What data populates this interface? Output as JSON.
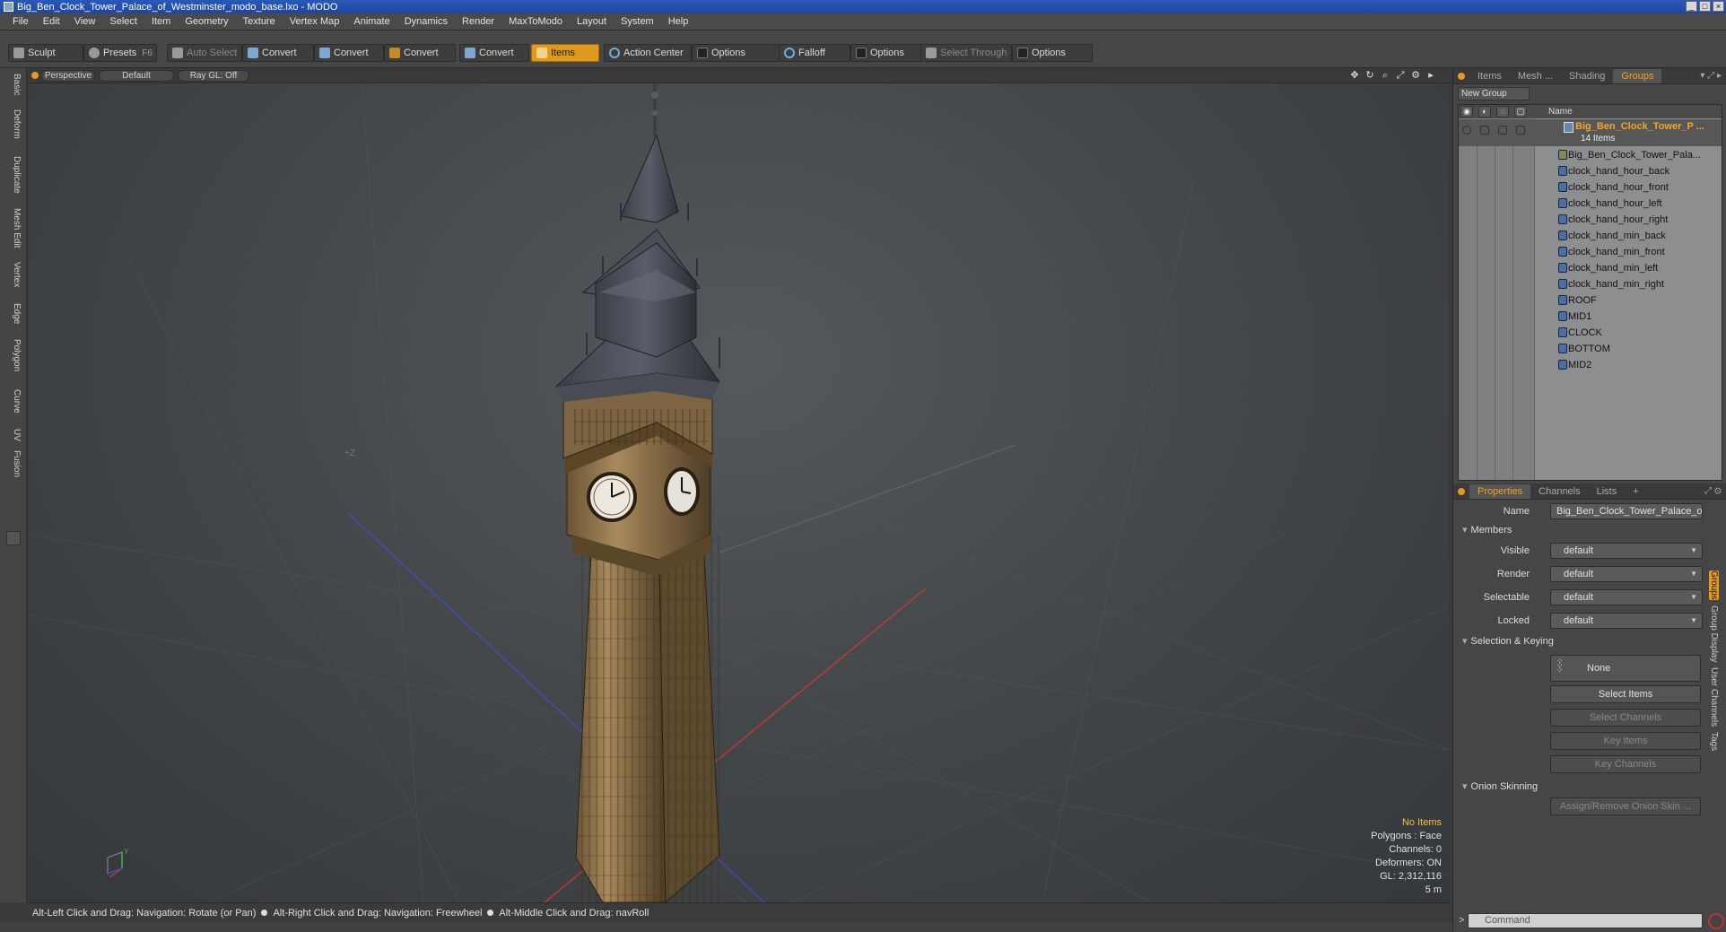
{
  "window": {
    "title": "Big_Ben_Clock_Tower_Palace_of_Westminster_modo_base.lxo - MODO"
  },
  "menu": [
    "File",
    "Edit",
    "View",
    "Select",
    "Item",
    "Geometry",
    "Texture",
    "Vertex Map",
    "Animate",
    "Dynamics",
    "Render",
    "MaxToModo",
    "Layout",
    "System",
    "Help"
  ],
  "toolbar": {
    "sculpt": "Sculpt",
    "presets": "Presets",
    "presets_key": "F6",
    "auto_select": "Auto Select",
    "convert1": "Convert",
    "convert2": "Convert",
    "convert3": "Convert",
    "convert4": "Convert",
    "items": "Items",
    "action_center": "Action Center",
    "options1": "Options",
    "falloff": "Falloff",
    "options2": "Options",
    "select_through": "Select Through",
    "options3": "Options"
  },
  "left_tabs": [
    "Basic",
    "Deform",
    "Duplicate",
    "Mesh Edit",
    "Vertex",
    "Edge",
    "Polygon",
    "Curve",
    "UV",
    "Fusion"
  ],
  "viewport": {
    "view": "Perspective",
    "shading": "Default",
    "raygl": "Ray GL: Off",
    "info": {
      "selection": "No Items",
      "polygons": "Polygons : Face",
      "channels": "Channels: 0",
      "deformers": "Deformers: ON",
      "gl": "GL: 2,312,116",
      "scale": "5 m"
    },
    "axis_y": "Y"
  },
  "status": {
    "hint1": "Alt-Left Click and Drag: Navigation: Rotate (or Pan)",
    "hint2": "Alt-Right Click and Drag: Navigation: Freewheel",
    "hint3": "Alt-Middle Click and Drag: navRoll"
  },
  "top_tabs": {
    "items": "Items",
    "mesh": "Mesh ...",
    "shading": "Shading",
    "groups": "Groups"
  },
  "groups": {
    "new_group": "New Group",
    "col_name": "Name",
    "group_name": "Big_Ben_Clock_Tower_P ...",
    "group_count": "14 Items",
    "members": [
      "Big_Ben_Clock_Tower_Pala...",
      "clock_hand_hour_back",
      "clock_hand_hour_front",
      "clock_hand_hour_left",
      "clock_hand_hour_right",
      "clock_hand_min_back",
      "clock_hand_min_front",
      "clock_hand_min_left",
      "clock_hand_min_right",
      "ROOF",
      "MID1",
      "CLOCK",
      "BOTTOM",
      "MID2"
    ]
  },
  "bottom_tabs": {
    "properties": "Properties",
    "channels": "Channels",
    "lists": "Lists",
    "add": "+"
  },
  "properties": {
    "name_label": "Name",
    "name_value": "Big_Ben_Clock_Tower_Palace_of",
    "members_section": "Members",
    "visible_label": "Visible",
    "visible_value": "default",
    "render_label": "Render",
    "render_value": "default",
    "selectable_label": "Selectable",
    "selectable_value": "default",
    "locked_label": "Locked",
    "locked_value": "default",
    "selection_section": "Selection & Keying",
    "none_btn": "None",
    "select_items": "Select Items",
    "select_channels": "Select Channels",
    "key_items": "Key Items",
    "key_channels": "Key Channels",
    "onion_section": "Onion Skinning",
    "onion_btn": "Assign/Remove Onion Skin ..."
  },
  "side_vtabs": [
    "Groups",
    "Group Display",
    "User Channels",
    "Tags"
  ],
  "command": {
    "placeholder": "Command"
  },
  "colors": {
    "accent": "#e59a1f",
    "selection_text": "#f0c14b"
  }
}
